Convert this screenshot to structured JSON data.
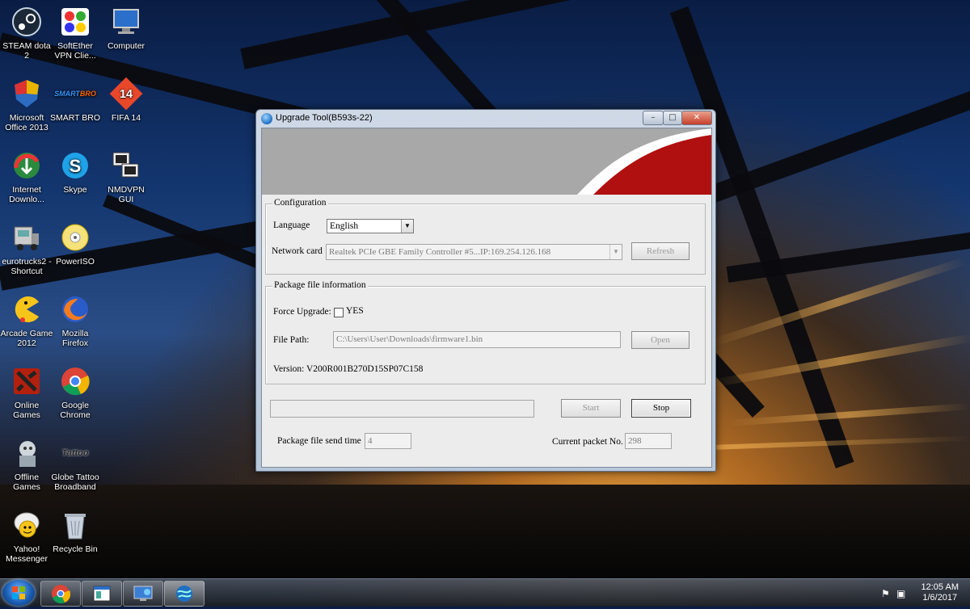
{
  "desktop": {
    "icons": [
      {
        "label": "STEAM dota 2",
        "icon": "steam-icon"
      },
      {
        "label": "SoftEther VPN Clie...",
        "icon": "softether-icon"
      },
      {
        "label": "Computer",
        "icon": "computer-icon"
      },
      {
        "label": "Microsoft Office 2013",
        "icon": "office-shield-icon"
      },
      {
        "label": "SMART BRO",
        "icon": "smart-bro-icon"
      },
      {
        "label": "FIFA 14",
        "icon": "fifa-icon"
      },
      {
        "label": "Internet Downlo...",
        "icon": "idm-icon"
      },
      {
        "label": "Skype",
        "icon": "skype-icon"
      },
      {
        "label": "NMDVPN GUI",
        "icon": "nmdvpn-icon"
      },
      {
        "label": "eurotrucks2 - Shortcut",
        "icon": "truck-icon"
      },
      {
        "label": "PowerISO",
        "icon": "poweriso-icon"
      },
      {
        "label": "Arcade Game 2012",
        "icon": "pacman-icon"
      },
      {
        "label": "Mozilla Firefox",
        "icon": "firefox-icon"
      },
      {
        "label": "Online Games",
        "icon": "dota-icon"
      },
      {
        "label": "Google Chrome",
        "icon": "chrome-icon"
      },
      {
        "label": "Offline Games",
        "icon": "offline-games-icon"
      },
      {
        "label": "Globe Tattoo Broadband",
        "icon": "tattoo-icon"
      },
      {
        "label": "Yahoo! Messenger",
        "icon": "yahoo-icon"
      },
      {
        "label": "Recycle Bin",
        "icon": "recycle-bin-icon"
      }
    ],
    "smart_logo_text": "SMART",
    "smart_logo_sub": "BRO",
    "fifa_text": "14",
    "tattoo_text": "Tattoo"
  },
  "window": {
    "title": "Upgrade Tool(B593s-22)",
    "configuration": {
      "group_title": "Configuration",
      "language_label": "Language",
      "language_value": "English",
      "network_label": "Network card",
      "network_value": "Realtek PCIe GBE Family Controller #5...IP:169.254.126.168",
      "refresh_label": "Refresh"
    },
    "package": {
      "group_title": "Package file information",
      "force_label": "Force Upgrade:",
      "force_option": "YES",
      "file_path_label": "File Path:",
      "file_path_value": "C:\\Users\\User\\Downloads\\firmware1.bin",
      "open_label": "Open",
      "version_text": "Version: V200R001B270D15SP07C158"
    },
    "start_label": "Start",
    "stop_label": "Stop",
    "send_time_label": "Package file send time",
    "send_time_value": "4",
    "packet_label": "Current packet No.",
    "packet_value": "298"
  },
  "taskbar": {
    "time": "12:05 AM",
    "date": "1/6/2017",
    "buttons": [
      "chrome-icon",
      "window-icon",
      "network-icon",
      "upgrade-tool-icon"
    ]
  },
  "colors": {
    "banner_red": "#b01010",
    "banner_gray": "#a8a8a8"
  }
}
